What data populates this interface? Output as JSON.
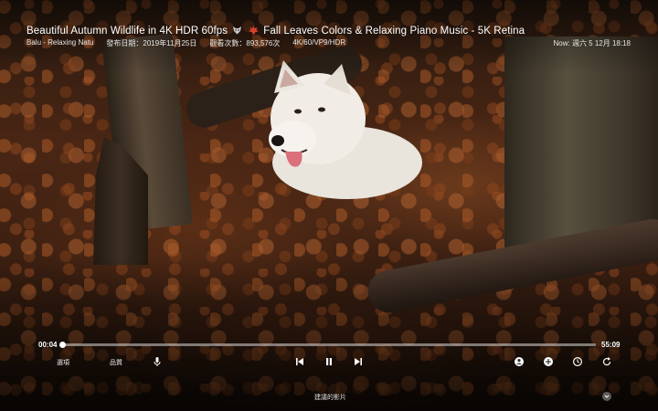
{
  "video": {
    "title_part1": "Beautiful Autumn Wildlife in 4K HDR 60fps",
    "title_part2": "Fall Leaves Colors & Relaxing Piano Music - 5K Retina",
    "title_icons": [
      "wolf-emoji-icon",
      "maple-leaf-emoji-icon"
    ],
    "channel": "Balu - Relaxing Natu",
    "publish_date": "發布日期：2019年11月25日",
    "views": "觀看次數：893,576次",
    "format": "4K/60/VP9/HDR"
  },
  "status": {
    "clock": "Now: 週六 5 12月 18:18"
  },
  "player": {
    "current_time": "00:04",
    "duration": "55:09",
    "progress_fraction": 0.0012,
    "options_label": "選項",
    "quality_label": "品質",
    "suggested_label": "建議的影片"
  },
  "colors": {
    "accent": "#ffffff",
    "track": "#bfbfbf",
    "leaf_red": "#d8402a"
  }
}
